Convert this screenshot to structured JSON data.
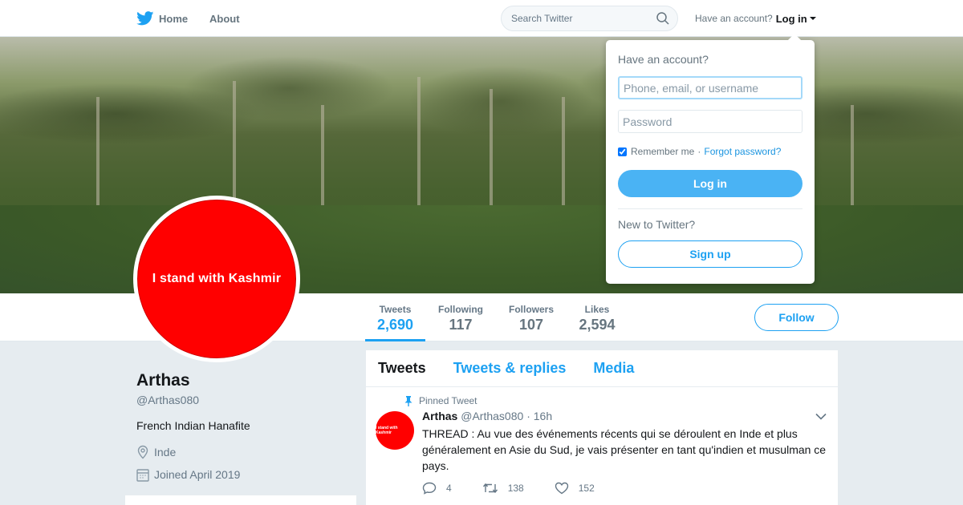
{
  "nav": {
    "home_label": "Home",
    "about_label": "About",
    "search_placeholder": "Search Twitter",
    "have_account": "Have an account?",
    "login_label": "Log in"
  },
  "profile": {
    "avatar_text": "I stand with Kashmir",
    "name": "Arthas",
    "handle": "@Arthas080",
    "bio": "French Indian Hanafite",
    "location": "Inde",
    "joined": "Joined April 2019",
    "follow_label": "Follow"
  },
  "stats": [
    {
      "label": "Tweets",
      "value": "2,690",
      "active": true
    },
    {
      "label": "Following",
      "value": "117"
    },
    {
      "label": "Followers",
      "value": "107"
    },
    {
      "label": "Likes",
      "value": "2,594"
    }
  ],
  "timeline": {
    "tabs": [
      "Tweets",
      "Tweets & replies",
      "Media"
    ],
    "active_tab": "Tweets",
    "tweet": {
      "pinned_label": "Pinned Tweet",
      "name": "Arthas",
      "handle": "@Arthas080",
      "separator": "·",
      "time": "16h",
      "avatar_text": "I stand with Kashmir",
      "text": "THREAD : Au vue des événements récents qui se déroulent en Inde et plus généralement en Asie du Sud, je vais présenter en tant qu'indien et musulman ce pays.",
      "replies": "4",
      "retweets": "138",
      "likes": "152"
    }
  },
  "login_dropdown": {
    "title": "Have an account?",
    "username_placeholder": "Phone, email, or username",
    "password_placeholder": "Password",
    "remember_label": "Remember me",
    "separator": "·",
    "forgot_label": "Forgot password?",
    "login_button": "Log in",
    "new_label": "New to Twitter?",
    "signup_button": "Sign up"
  },
  "colors": {
    "accent": "#1da1f2",
    "avatar_red": "#ff0000",
    "page_bg": "#e6ecf0"
  }
}
